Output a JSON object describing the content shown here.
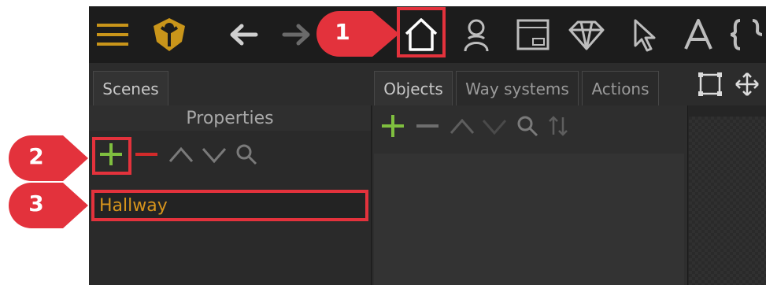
{
  "colors": {
    "accent_red": "#e3323c",
    "brand_gold": "#c9951a",
    "add_green": "#7fbf3f",
    "remove_red": "#d22a2a",
    "icon_gray": "#7a7a7a",
    "scene_text": "#d7941c"
  },
  "toolbar": {
    "icons": [
      "menu-icon",
      "logo-icon",
      "back-arrow-icon",
      "forward-arrow-icon",
      "settings-icon",
      "home-icon",
      "user-icon",
      "dialog-icon",
      "diamond-icon",
      "cursor-icon",
      "font-icon",
      "braces-icon"
    ]
  },
  "left_panel": {
    "tab_label": "Scenes",
    "section_title": "Properties",
    "items": [
      {
        "label": "Hallway"
      }
    ]
  },
  "middle_panel": {
    "tabs": [
      {
        "label": "Objects"
      },
      {
        "label": "Way systems"
      },
      {
        "label": "Actions"
      }
    ]
  },
  "callouts": [
    {
      "number": "1"
    },
    {
      "number": "2"
    },
    {
      "number": "3"
    }
  ]
}
